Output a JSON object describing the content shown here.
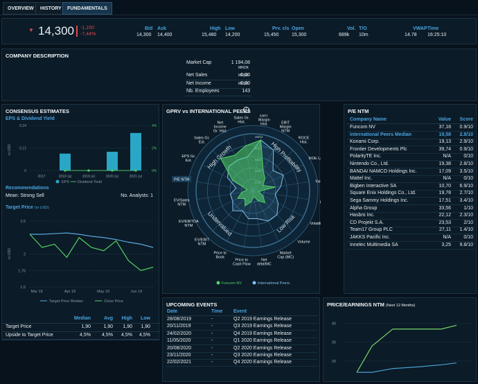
{
  "tabs": [
    "OVERVIEW",
    "HISTORY",
    "FUNDAMENTALS"
  ],
  "quote": {
    "price": "14,300",
    "chg_abs": "-1,150",
    "chg_pct": "-7,44%",
    "fields": [
      {
        "label": "Bid",
        "value": "14,300"
      },
      {
        "label": "Ask",
        "value": "14,400"
      },
      {
        "label": "High",
        "value": "15,480"
      },
      {
        "label": "Low",
        "value": "14,200"
      },
      {
        "label": "Prv. cls",
        "value": "15,450"
      },
      {
        "label": "Open",
        "value": "15,300"
      },
      {
        "label": "Vol.",
        "value": "689k"
      },
      {
        "label": "T/O",
        "value": "10m"
      },
      {
        "label": "VWAP",
        "value": "14.78"
      },
      {
        "label": "Time",
        "value": "16:25:10"
      }
    ]
  },
  "company_desc": {
    "title": "COMPANY DESCRIPTION",
    "rows": [
      {
        "label": "Market Cap",
        "value": "1 194,08",
        "unit": "MNOK"
      },
      {
        "label": "Net Sales",
        "value": "0,00",
        "unit": "MUSD"
      },
      {
        "label": "Net Income",
        "value": "0,00",
        "unit": "MUSD"
      },
      {
        "label": "Nb. Employees",
        "value": "143",
        "unit": ""
      }
    ]
  },
  "consensus": {
    "title": "CONSENSUS ESTIMATES",
    "eps_title": "EPS & Dividend Yield",
    "eps_y": [
      "0.24",
      "0.12",
      "0"
    ],
    "div_y": [
      "4%",
      "2%",
      "0%"
    ],
    "ylabel": "in USD",
    "years": [
      "2017",
      "2018 (a)",
      "2019 (e)",
      "2020 (e)",
      "2021 (e)"
    ],
    "legend_eps": "EPS",
    "legend_div": "Dividend Yield",
    "rec_title": "Recommendations",
    "rec_mean": "Mean: Strong Sell",
    "rec_analysts": "No. Analysts: 1",
    "tp_title": "Target Price",
    "tp_unit": "(in USD)",
    "tp_y": [
      "2.5",
      "2",
      "1.75",
      "1.5"
    ],
    "tp_ylabel": "in USD",
    "tp_x": [
      "Mar 19",
      "Apr 19",
      "May 19",
      "Jun 19"
    ],
    "legend_tpm": "Target Price Median",
    "legend_cp": "Close Price",
    "table_headers": [
      "Median",
      "Avg",
      "High",
      "Low"
    ],
    "table": [
      {
        "label": "Target Price",
        "vals": [
          "1,90",
          "1,90",
          "1,90",
          "1,90"
        ]
      },
      {
        "label": "Upside to Target Price",
        "vals": [
          "4,5%",
          "4,5%",
          "4,5%",
          "4,5%"
        ]
      }
    ]
  },
  "radar": {
    "title": "GPRV vs INTERNATIONAL PEERS",
    "info_icon": "i",
    "rings": [
      "10/10",
      "8/10",
      "6/10",
      "4/10",
      "2/10"
    ],
    "quadrants": [
      "High Growth",
      "High Profitability",
      "Low Risk",
      "Undervalued"
    ],
    "axes": [
      "EBIT Margin Hist.",
      "EBIT Margin NTM",
      "ROCE Hist.",
      "ROE Last",
      "Div. Yield NTM",
      "Beta",
      "Volatility",
      "Volume",
      "Market Cap (MC)",
      "Net debt/MC",
      "Price to Cash Flow",
      "Price to Book",
      "EV/EBIT NTM",
      "EV/EBITDA NTM",
      "EV/Sales NTM",
      "P/E NTM",
      "EPS Gr. Est.",
      "Sales Gr. Est.",
      "Net Income Gr. Hist.",
      "Sales Gr. Hist."
    ],
    "highlight": "P/E NTM",
    "legend_a": "Funcom NV",
    "legend_b": "International Peers"
  },
  "pe": {
    "title": "P/E NTM",
    "headers": [
      "Company Name",
      "Value",
      "Score"
    ],
    "rows": [
      {
        "name": "Funcom NV",
        "value": "37,18",
        "score": "0.9/10",
        "hl": false
      },
      {
        "name": "International Peers Median",
        "value": "19,58",
        "score": "2.8/10",
        "hl": true
      },
      {
        "name": "Konami Corp.",
        "value": "19,13",
        "score": "2.9/10",
        "hl": false
      },
      {
        "name": "Frontier Developments Plc",
        "value": "39,74",
        "score": "0.9/10",
        "hl": false
      },
      {
        "name": "PolarityTE Inc.",
        "value": "N/A",
        "score": "0/10",
        "hl": false
      },
      {
        "name": "Nintendo Co., Ltd.",
        "value": "19,38",
        "score": "2.8/10",
        "hl": false
      },
      {
        "name": "BANDAI NAMCO Holdings Inc.",
        "value": "17,09",
        "score": "3.5/10",
        "hl": false
      },
      {
        "name": "Mattel Inc.",
        "value": "N/A",
        "score": "0/10",
        "hl": false
      },
      {
        "name": "Bigben Interactive SA",
        "value": "10,70",
        "score": "6.9/10",
        "hl": false
      },
      {
        "name": "Square Enix Holdings Co., Ltd.",
        "value": "19,78",
        "score": "2.7/10",
        "hl": false
      },
      {
        "name": "Sega Sammy Holdings Inc.",
        "value": "17,51",
        "score": "3.4/10",
        "hl": false
      },
      {
        "name": "Alpha Group",
        "value": "33,56",
        "score": "1/10",
        "hl": false
      },
      {
        "name": "Hasbro Inc.",
        "value": "22,12",
        "score": "2.3/10",
        "hl": false
      },
      {
        "name": "CD Projekt S.A.",
        "value": "23,53",
        "score": "2/10",
        "hl": false
      },
      {
        "name": "Team17 Group PLC",
        "value": "27,11",
        "score": "1.4/10",
        "hl": false
      },
      {
        "name": "JAKKS Pacific Inc.",
        "value": "N/A",
        "score": "0/10",
        "hl": false
      },
      {
        "name": "Innelec Multimedia SA",
        "value": "3,25",
        "score": "9.8/10",
        "hl": false
      }
    ]
  },
  "events": {
    "title": "UPCOMING EVENTS",
    "headers": [
      "Date",
      "Time",
      "Event"
    ],
    "rows": [
      {
        "date": "28/08/2019",
        "time": "-",
        "event": "Q2 2019 Earnings Release"
      },
      {
        "date": "20/11/2019",
        "time": "-",
        "event": "Q3 2019 Earnings Release"
      },
      {
        "date": "24/02/2020",
        "time": "-",
        "event": "Q4 2019 Earnings Release"
      },
      {
        "date": "11/05/2020",
        "time": "-",
        "event": "Q1 2020 Earnings Release"
      },
      {
        "date": "20/08/2020",
        "time": "-",
        "event": "Q2 2020 Earnings Release"
      },
      {
        "date": "23/11/2020",
        "time": "-",
        "event": "Q3 2020 Earnings Release"
      },
      {
        "date": "22/02/2021",
        "time": "-",
        "event": "Q4 2020 Earnings Release"
      }
    ]
  },
  "pe_chart": {
    "title": "PRICE/EARNINGS NTM",
    "subtitle": "(Next 12 Months)",
    "y": [
      "40",
      "30",
      "20"
    ]
  },
  "chart_data": [
    {
      "type": "bar",
      "title": "EPS & Dividend Yield",
      "categories": [
        "2017",
        "2018 (a)",
        "2019 (e)",
        "2020 (e)",
        "2021 (e)"
      ],
      "series": [
        {
          "name": "EPS",
          "values": [
            null,
            0.09,
            null,
            0.1,
            0.2
          ]
        },
        {
          "name": "Dividend Yield",
          "values": [
            null,
            0,
            0,
            0,
            0
          ]
        }
      ],
      "ylim": [
        0,
        0.24
      ],
      "ylim_right": [
        0,
        4
      ]
    },
    {
      "type": "line",
      "title": "Target Price",
      "x": [
        "Mar 19",
        "Apr 19",
        "May 19",
        "Jun 19"
      ],
      "series": [
        {
          "name": "Target Price Median",
          "values": [
            2.3,
            2.3,
            2.31,
            2.32,
            2.3,
            2.27,
            2.25,
            2.22,
            2.18,
            2.15,
            2.1
          ]
        },
        {
          "name": "Close Price",
          "values": [
            2.3,
            2.1,
            2.15,
            1.95,
            2.25,
            2.1,
            2.05,
            2.2,
            1.9,
            1.75,
            1.8
          ]
        }
      ],
      "ylim": [
        1.5,
        2.5
      ]
    },
    {
      "type": "line",
      "title": "PRICE/EARNINGS NTM",
      "series": [
        {
          "values": [
            14,
            28,
            37,
            37,
            37,
            39
          ]
        },
        {
          "values": [
            14,
            14,
            16,
            17,
            18,
            19
          ]
        }
      ],
      "ylim": [
        10,
        45
      ]
    },
    {
      "type": "radar",
      "title": "GPRV vs INTERNATIONAL PEERS",
      "series": [
        {
          "name": "Funcom NV",
          "values": [
            9,
            4,
            3,
            2,
            4,
            1,
            2,
            3,
            2,
            1,
            2,
            3,
            2,
            3,
            2,
            1,
            4,
            8,
            7,
            8
          ]
        },
        {
          "name": "International Peers",
          "values": [
            9,
            8,
            5,
            6,
            5,
            4,
            5,
            6,
            6,
            5,
            5,
            4,
            5,
            4,
            4,
            3,
            5,
            6,
            6,
            6
          ]
        }
      ]
    }
  ]
}
